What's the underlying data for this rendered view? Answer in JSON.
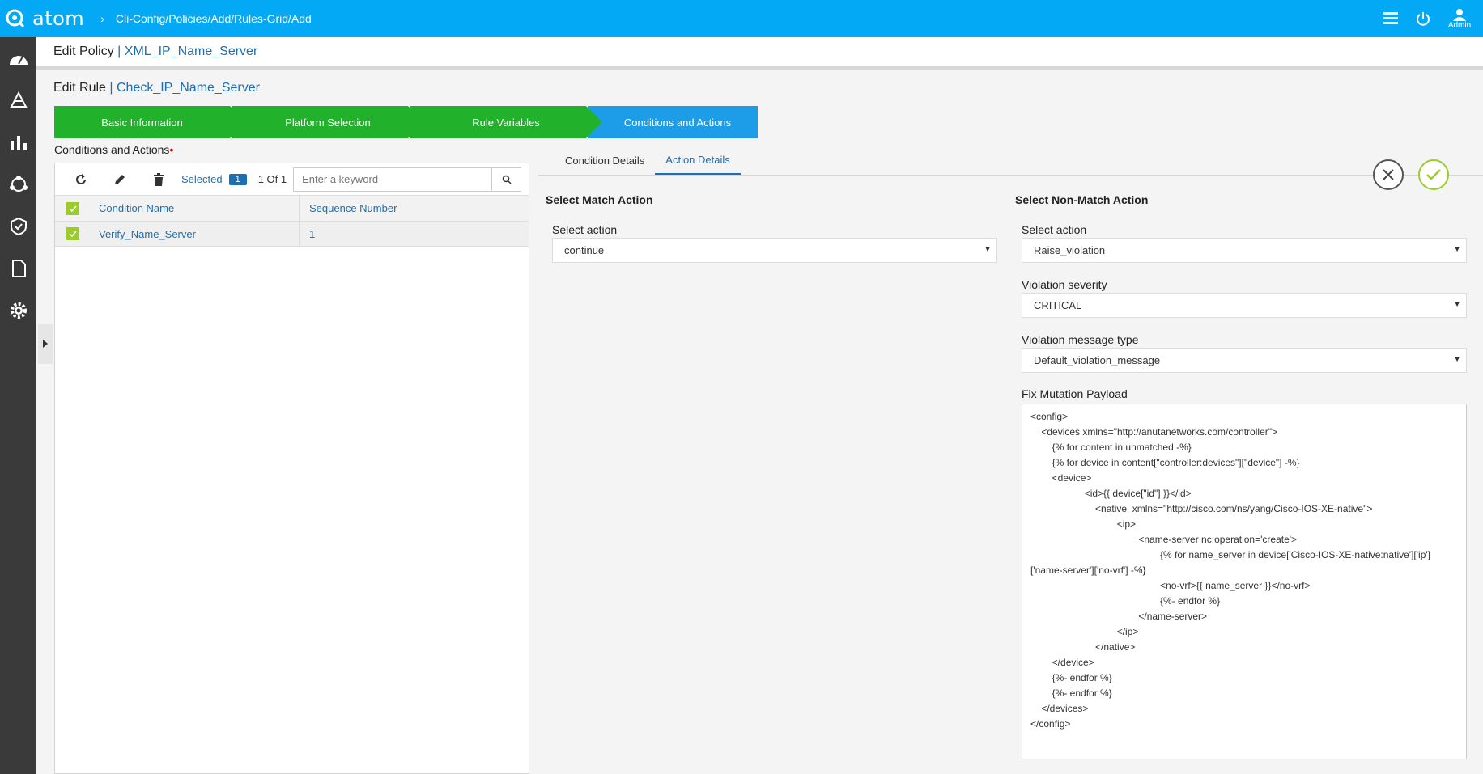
{
  "topbar": {
    "brand": "atom",
    "breadcrumb_sep": "›",
    "breadcrumb": "Cli-Config/Policies/Add/Rules-Grid/Add",
    "user_label": "Admin"
  },
  "sidebar": {
    "items": [
      "dashboard-icon",
      "resources-icon",
      "analytics-icon",
      "topology-icon",
      "compliance-icon",
      "document-icon",
      "settings-icon"
    ]
  },
  "page": {
    "policy_prefix": "Edit Policy",
    "separator": "|",
    "policy_name": "XML_IP_Name_Server",
    "rule_prefix": "Edit Rule",
    "rule_name": "Check_IP_Name_Server"
  },
  "wizard": {
    "steps": [
      "Basic Information",
      "Platform Selection",
      "Rule Variables",
      "Conditions and Actions"
    ],
    "active_index": 3
  },
  "conditions": {
    "title": "Conditions and Actions",
    "required_mark": "•",
    "toolbar": {
      "selected_label": "Selected",
      "selected_count": "1",
      "page_count": "1 Of 1",
      "search_placeholder": "Enter a keyword"
    },
    "columns": [
      "Condition Name",
      "Sequence Number"
    ],
    "rows": [
      {
        "name": "Verify_Name_Server",
        "sequence": "1",
        "checked": true
      }
    ]
  },
  "details": {
    "tabs": [
      "Condition Details",
      "Action Details"
    ],
    "active_tab": 1,
    "match": {
      "title": "Select Match Action",
      "action_label": "Select action",
      "action_value": "continue"
    },
    "non_match": {
      "title": "Select Non-Match Action",
      "action_label": "Select action",
      "action_value": "Raise_violation",
      "severity_label": "Violation severity",
      "severity_value": "CRITICAL",
      "message_type_label": "Violation message type",
      "message_type_value": "Default_violation_message",
      "payload_label": "Fix Mutation Payload",
      "payload": "<config>\n    <devices xmlns=\"http://anutanetworks.com/controller\">\n        {% for content in unmatched -%}\n        {% for device in content[\"controller:devices\"][\"device\"] -%}\n        <device>\n                    <id>{{ device[\"id\"] }}</id>\n                        <native  xmlns=\"http://cisco.com/ns/yang/Cisco-IOS-XE-native\">\n                                <ip>\n                                        <name-server nc:operation='create'>\n                                                {% for name_server in device['Cisco-IOS-XE-native:native']['ip']\n['name-server']['no-vrf'] -%}\n                                                <no-vrf>{{ name_server }}</no-vrf>\n                                                {%- endfor %}\n                                        </name-server>\n                                </ip>\n                        </native>\n        </device>\n        {%- endfor %}\n        {%- endfor %}\n    </devices>\n</config>"
    }
  },
  "colors": {
    "topbar": "#03a9f4",
    "step_done": "#22b12a",
    "step_active": "#1d9de8",
    "link": "#1c6fb3",
    "checkbox": "#9ccc2c"
  }
}
